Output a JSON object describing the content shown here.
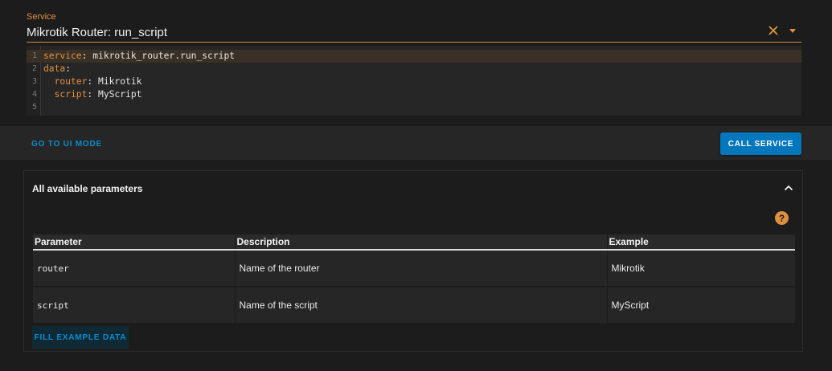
{
  "service": {
    "label": "Service",
    "value": "Mikrotik Router: run_script"
  },
  "editor": {
    "lines": [
      {
        "n": "1",
        "key": "service",
        "rest": ": mikrotik_router.run_script"
      },
      {
        "n": "2",
        "key": "data",
        "rest": ":"
      },
      {
        "n": "3",
        "key": "  router",
        "rest": ": Mikrotik"
      },
      {
        "n": "4",
        "key": "  script",
        "rest": ": MyScript"
      },
      {
        "n": "5",
        "key": "",
        "rest": ""
      }
    ]
  },
  "actions": {
    "ui_mode": "GO TO UI MODE",
    "call_service": "CALL SERVICE"
  },
  "parameters": {
    "title": "All available parameters",
    "help_glyph": "?",
    "headers": [
      "Parameter",
      "Description",
      "Example"
    ],
    "rows": [
      {
        "param": "router",
        "description": "Name of the router",
        "example": "Mikrotik"
      },
      {
        "param": "script",
        "description": "Name of the script",
        "example": "MyScript"
      }
    ],
    "fill_button": "FILL EXAMPLE DATA"
  },
  "colors": {
    "accent": "#e0913f",
    "primary": "#0377be",
    "link": "#0b8dcd",
    "background": "#1c1c1c"
  },
  "icons": [
    "close-icon",
    "dropdown-arrow-icon",
    "chevron-up-icon",
    "help-icon"
  ]
}
